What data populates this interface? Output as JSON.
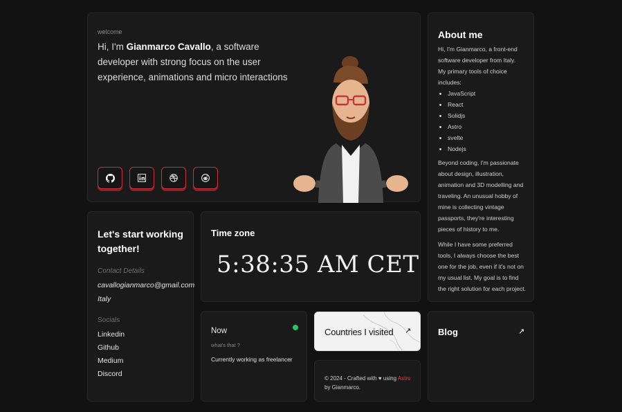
{
  "hero": {
    "welcome": "welcome",
    "intro_prefix": "Hi, I'm ",
    "name": "Gianmarco Cavallo",
    "intro_suffix": ", a software developer with strong focus on the user experience, animations and micro interactions",
    "socials": [
      {
        "name": "github",
        "icon": "github-icon"
      },
      {
        "name": "linkedin",
        "icon": "linkedin-icon"
      },
      {
        "name": "dribbble",
        "icon": "dribbble-icon"
      },
      {
        "name": "reddit",
        "icon": "reddit-icon"
      }
    ],
    "accent_color": "#c9343b"
  },
  "about": {
    "title": "About me",
    "intro": "Hi, I'm Gianmarco, a front-end software developer from Italy.",
    "tools_intro": "My primary tools of choice includes:",
    "tools": [
      "JavaScript",
      "React",
      "Solidjs",
      "Astro",
      "svelte",
      "Nodejs"
    ],
    "paragraph1": "Beyond coding, I'm passionate about design, illustration, animation and 3D modelling and traveling. An unusual hobby of mine is collecting vintage passports, they're interesting pieces of history to me.",
    "paragraph2": "While I have some preferred tools, I always choose the best one for the job, even if it's not on my usual list. My goal is to find the right solution for each project."
  },
  "contact": {
    "title": "Let's start working together!",
    "details_label": "Contact Details",
    "email": "cavallogianmarco@gmail.com",
    "location": "Italy",
    "socials_label": "Socials",
    "links": [
      "Linkedin",
      "Github",
      "Medium",
      "Discord"
    ]
  },
  "timezone": {
    "title": "Time zone",
    "time": "5:38:35 AM CET"
  },
  "now": {
    "title": "Now",
    "subtitle": "what's that ?",
    "status": "Currently working as freelancer",
    "status_color": "#22c55e"
  },
  "countries": {
    "title": "Countries I visited",
    "arrow_icon": "arrow-up-right-icon"
  },
  "footer": {
    "prefix": "© 2024 - Crafted with ♥ using ",
    "tech": "Astro",
    "suffix": " by Gianmarco."
  },
  "blog": {
    "title": "Blog",
    "arrow_icon": "arrow-up-right-icon"
  }
}
